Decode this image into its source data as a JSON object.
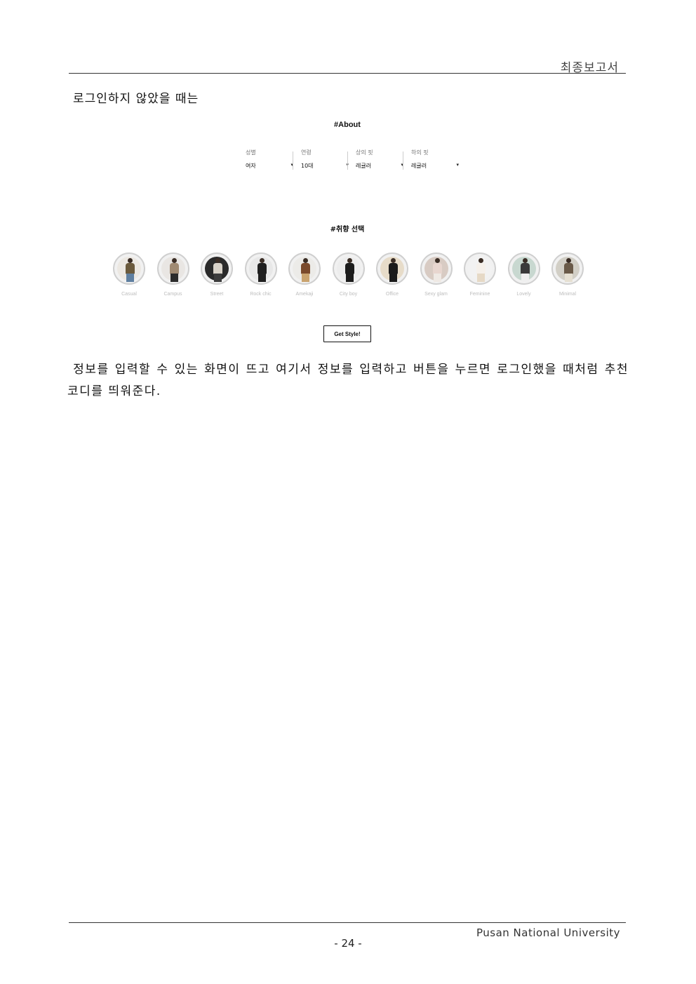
{
  "header": {
    "title": "최종보고서"
  },
  "intro_text": "로그인하지 않았을 때는",
  "ui": {
    "about_title": "#About",
    "filters": [
      {
        "label": "성별",
        "value": "여자"
      },
      {
        "label": "연령",
        "value": "10대"
      },
      {
        "label": "상의 핏",
        "value": "레귤러"
      },
      {
        "label": "하의 핏",
        "value": "레귤러"
      }
    ],
    "caret": "▾",
    "preference_title": "#취향 선택",
    "styles": [
      {
        "label": "Casual",
        "bg": "#ece8e2",
        "top": "#6b5a3c",
        "legs": "#5f7fa0"
      },
      {
        "label": "Campus",
        "bg": "#e9e6e3",
        "top": "#a08a72",
        "legs": "#2b2b2b"
      },
      {
        "label": "Street",
        "bg": "#2a2a2a",
        "top": "#d8d2c8",
        "legs": "#3c3c3c"
      },
      {
        "label": "Rock chic",
        "bg": "#e8e8e8",
        "top": "#1f1f1f",
        "legs": "#1f1f1f"
      },
      {
        "label": "Amekaji",
        "bg": "#ecebe8",
        "top": "#7a4a2c",
        "legs": "#c9a36f"
      },
      {
        "label": "City boy",
        "bg": "#ededed",
        "top": "#1c1c1c",
        "legs": "#1c1c1c"
      },
      {
        "label": "Office",
        "bg": "#e7dcc9",
        "top": "#1b1b1b",
        "legs": "#1b1b1b"
      },
      {
        "label": "Sexy glam",
        "bg": "#d8cbc3",
        "top": "#e8d6cf",
        "legs": "#efe9e4"
      },
      {
        "label": "Feminine",
        "bg": "#f2f2f2",
        "top": "#f5f0ea",
        "legs": "#e6d9c6"
      },
      {
        "label": "Lovely",
        "bg": "#c8d8d0",
        "top": "#3a3a3a",
        "legs": "#efefef"
      },
      {
        "label": "Minimal",
        "bg": "#d2cfc6",
        "top": "#6a5a48",
        "legs": "#e6e0d2"
      }
    ],
    "button_label": "Get Style!"
  },
  "body_text": "정보를 입력할 수 있는 화면이 뜨고 여기서 정보를 입력하고 버튼을 누르면 로그인했을 때처럼 추천 코디를 띄워준다.",
  "footer": {
    "university": "Pusan National University",
    "page_number": "- 24 -"
  }
}
